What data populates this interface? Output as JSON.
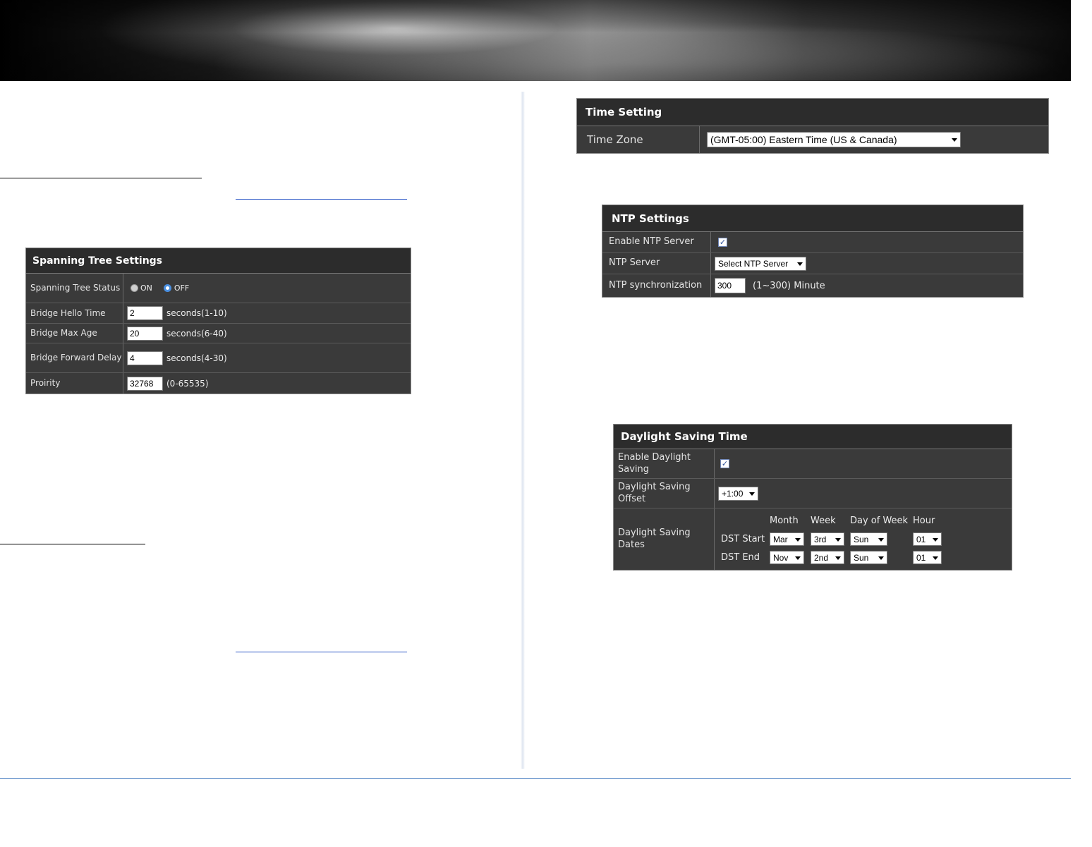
{
  "spanning_tree": {
    "title": "Spanning Tree Settings",
    "status_label": "Spanning Tree Status",
    "radio_on": "ON",
    "radio_off": "OFF",
    "hello_label": "Bridge Hello Time",
    "hello_value": "2",
    "hello_hint": "seconds(1-10)",
    "maxage_label": "Bridge Max Age",
    "maxage_value": "20",
    "maxage_hint": "seconds(6-40)",
    "fwd_label": "Bridge Forward Delay",
    "fwd_value": "4",
    "fwd_hint": "seconds(4-30)",
    "priority_label": "Proirity",
    "priority_value": "32768",
    "priority_hint": "(0-65535)"
  },
  "time_setting": {
    "title": "Time Setting",
    "zone_label": "Time Zone",
    "zone_value": "(GMT-05:00) Eastern Time (US & Canada)"
  },
  "ntp": {
    "title": "NTP Settings",
    "enable_label": "Enable NTP Server",
    "server_label": "NTP Server",
    "server_value": "Select NTP Server",
    "sync_label": "NTP synchronization",
    "sync_value": "300",
    "sync_hint": "(1~300) Minute"
  },
  "dst": {
    "title": "Daylight Saving Time",
    "enable_label": "Enable Daylight Saving",
    "offset_label": "Daylight Saving Offset",
    "offset_value": "+1:00",
    "dates_label": "Daylight Saving Dates",
    "col_month": "Month",
    "col_week": "Week",
    "col_dow": "Day of Week",
    "col_hour": "Hour",
    "start_label": "DST Start",
    "start_month": "Mar",
    "start_week": "3rd",
    "start_dow": "Sun",
    "start_hour": "01",
    "end_label": "DST End",
    "end_month": "Nov",
    "end_week": "2nd",
    "end_dow": "Sun",
    "end_hour": "01"
  }
}
